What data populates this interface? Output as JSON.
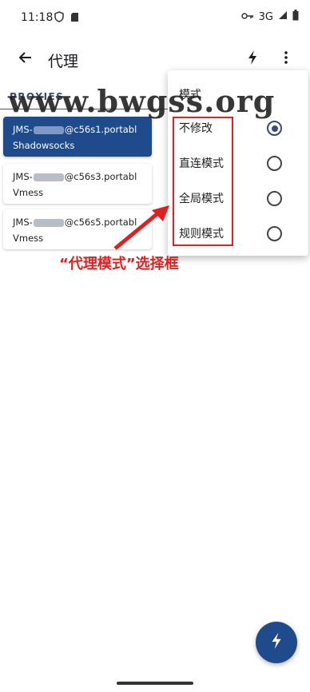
{
  "status_bar": {
    "time": "11:18",
    "network": "3G",
    "icons": [
      "shield-icon",
      "sd-card-icon",
      "vpn-key-icon",
      "signal-icon",
      "battery-icon"
    ]
  },
  "app_bar": {
    "title": "代理",
    "icons": [
      "back-arrow-icon",
      "bolt-icon",
      "more-vert-icon"
    ]
  },
  "section": {
    "label": "PROXIES"
  },
  "proxies": [
    {
      "name_prefix": "JMS-",
      "name_suffix": "@c56s1.portabl",
      "type": "Shadowsocks",
      "selected": true
    },
    {
      "name_prefix": "JMS-",
      "name_suffix": "@c56s3.portabl",
      "type": "Vmess",
      "selected": false
    },
    {
      "name_prefix": "JMS-",
      "name_suffix": "@c56s5.portabl",
      "type": "Vmess",
      "selected": false
    }
  ],
  "mode_menu": {
    "title": "模式",
    "options": [
      {
        "label": "不修改",
        "selected": true
      },
      {
        "label": "直连模式",
        "selected": false
      },
      {
        "label": "全局模式",
        "selected": false
      },
      {
        "label": "规则模式",
        "selected": false
      }
    ]
  },
  "watermark": "www.bwgss.org",
  "annotation": "“代理模式”选择框",
  "colors": {
    "primary": "#1f4a8c",
    "annotation": "#e02020",
    "background": "#ffffff"
  }
}
